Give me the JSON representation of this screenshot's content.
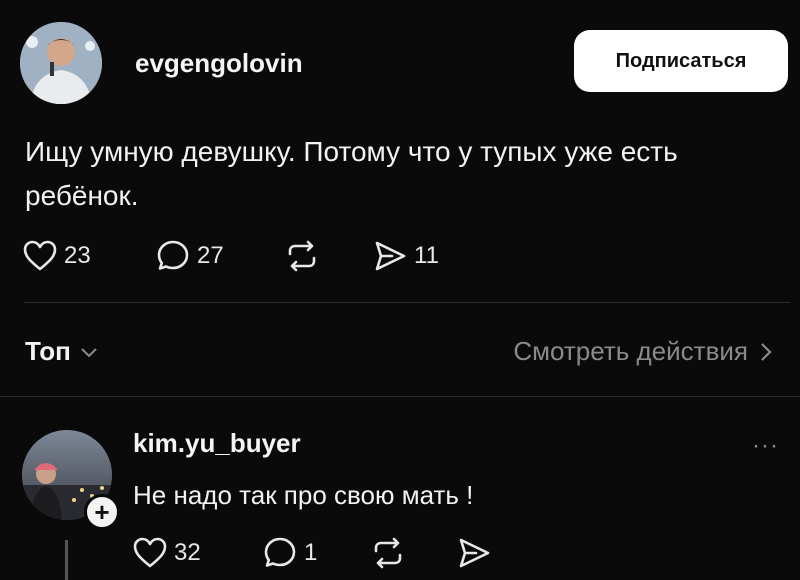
{
  "post": {
    "username": "evgengolovin",
    "follow_label": "Подписаться",
    "text": "Ищу умную девушку. Потому что у тупых уже есть ребёнок.",
    "likes": "23",
    "comments": "27",
    "shares": "11"
  },
  "replies_header": {
    "sort_label": "Топ",
    "activity_label": "Смотреть действия"
  },
  "reply": {
    "username": "kim.yu_buyer",
    "text": "Не надо так про свою мать !",
    "likes": "32",
    "comments": "1",
    "more": "···"
  },
  "icons": {
    "like": "heart-icon",
    "comment": "comment-icon",
    "repost": "repost-icon",
    "share": "send-icon",
    "dropdown": "chevron-down-icon",
    "forward": "chevron-right-icon",
    "follow_reply": "plus-icon"
  }
}
